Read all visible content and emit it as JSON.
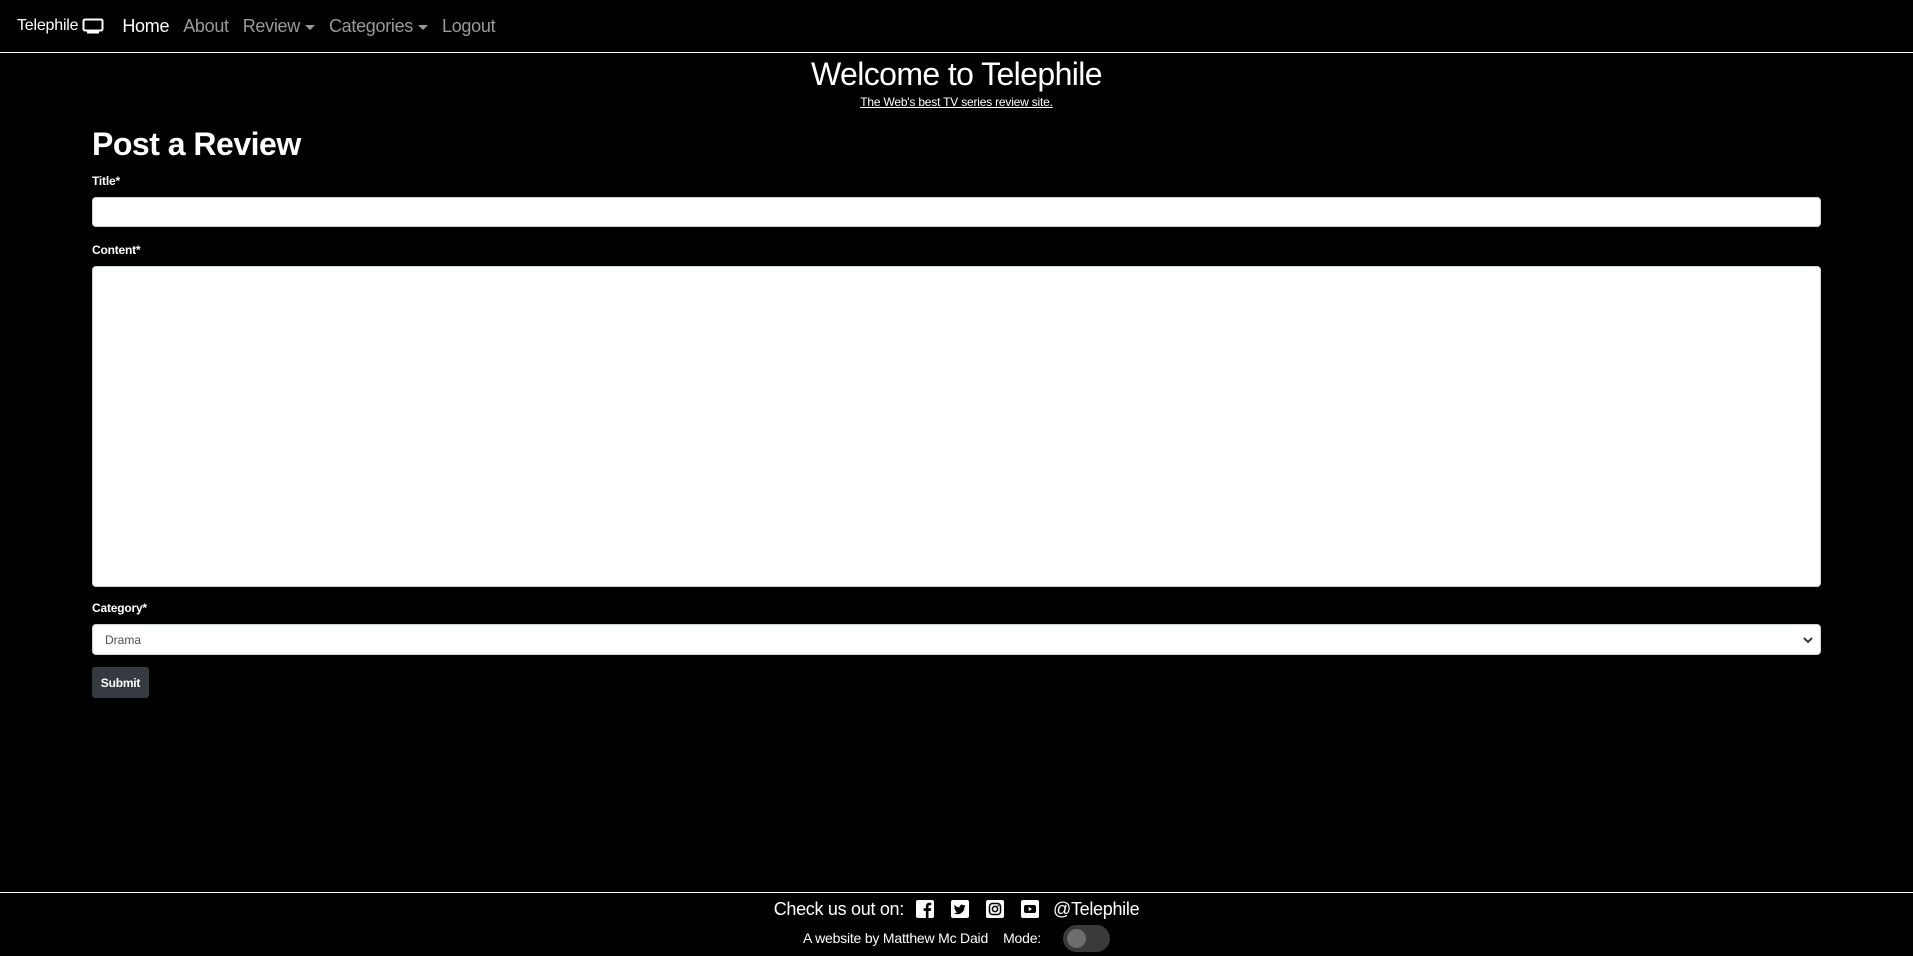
{
  "navbar": {
    "brand": "Telephile",
    "brand_icon": "tv-icon",
    "items": [
      {
        "label": "Home",
        "active": true,
        "dropdown": false
      },
      {
        "label": "About",
        "active": false,
        "dropdown": false
      },
      {
        "label": "Review",
        "active": false,
        "dropdown": true
      },
      {
        "label": "Categories",
        "active": false,
        "dropdown": true
      },
      {
        "label": "Logout",
        "active": false,
        "dropdown": false
      }
    ]
  },
  "header": {
    "title": "Welcome to Telephile",
    "tagline": "The Web's best TV series review site."
  },
  "form": {
    "heading": "Post a Review",
    "title_label": "Title*",
    "title_value": "",
    "content_label": "Content*",
    "content_value": "",
    "category_label": "Category*",
    "category_selected": "Drama",
    "submit_label": "Submit"
  },
  "footer": {
    "check_label": "Check us out on:",
    "social_icons": [
      "facebook-icon",
      "twitter-icon",
      "instagram-icon",
      "youtube-icon"
    ],
    "handle": "@Telephile",
    "credit": "A website by Matthew Mc Daid",
    "mode_label": "Mode:",
    "dark_mode_on": false
  },
  "colors": {
    "background": "#000000",
    "text": "#ffffff",
    "nav_inactive": "#9a9a9a",
    "button": "#343a40"
  }
}
